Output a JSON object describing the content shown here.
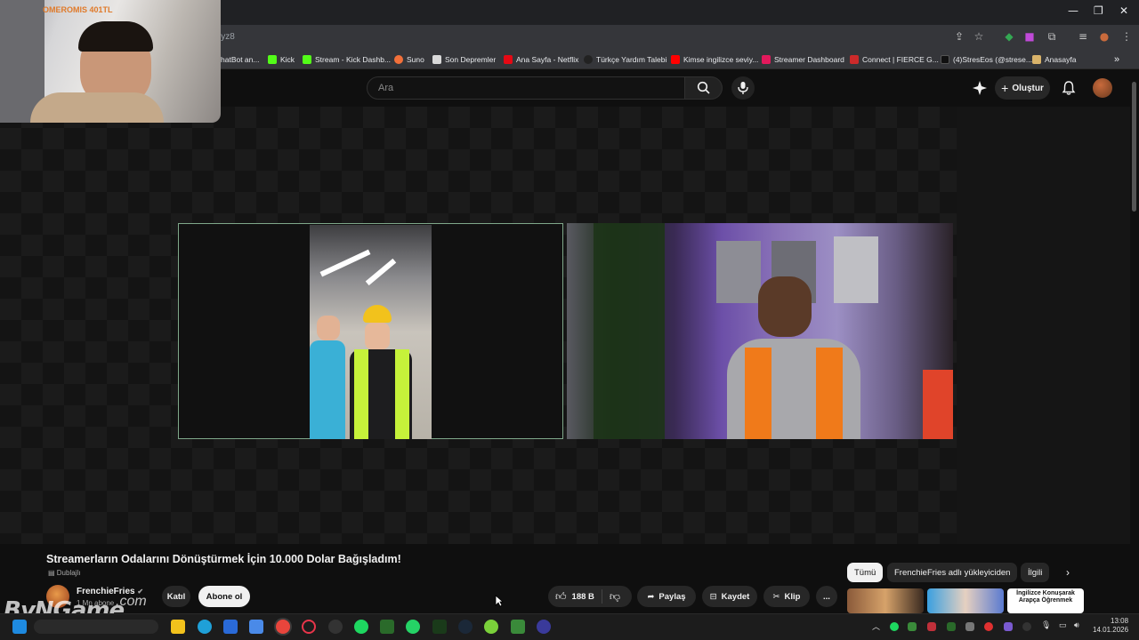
{
  "browser": {
    "url": "iyz8",
    "bookmarks": [
      {
        "label": "hatBot an...",
        "color": "#3a7bd5"
      },
      {
        "label": "Kick",
        "color": "#53fc18"
      },
      {
        "label": "Stream - Kick Dashb...",
        "color": "#53fc18"
      },
      {
        "label": "Suno",
        "color": "#f2703a"
      },
      {
        "label": "Son Depremler",
        "color": "#d9d9d9"
      },
      {
        "label": "Ana Sayfa - Netflix",
        "color": "#e50914"
      },
      {
        "label": "Türkçe Yardım Talebi",
        "color": "#222222"
      },
      {
        "label": "Kimse ingilizce seviy...",
        "color": "#ff0000"
      },
      {
        "label": "Streamer Dashboard",
        "color": "#e2195c"
      },
      {
        "label": "Connect | FIERCE G...",
        "color": "#cc2a2a"
      },
      {
        "label": "(4)StresEos (@strese...",
        "color": "#111111"
      },
      {
        "label": "Anasayfa",
        "color": "#d9b36a"
      }
    ],
    "more": "»"
  },
  "youtube": {
    "search_placeholder": "Ara",
    "create_label": "Oluştur",
    "video_title": "Streamerların Odalarını Dönüştürmek İçin 10.000 Dolar Bağışladım!",
    "dubbed": "Dublajlı",
    "channel_name": "FrenchieFries",
    "channel_subs": "1 Mn abone",
    "join_label": "Katıl",
    "subscribe_label": "Abone ol",
    "likes": "188 B",
    "share_label": "Paylaş",
    "save_label": "Kaydet",
    "clip_label": "Klip",
    "more": "...",
    "chips": [
      "Tümü",
      "FrenchieFries adlı yükleyiciden",
      "İlgili"
    ],
    "thumb3_text": "İngilizce Konuşarak Arapça Öğrenmek"
  },
  "overlay": {
    "webcam_label": "OMEROMIS 401TL",
    "watermark": "ByNGame",
    "watermark_com": ".com"
  },
  "taskbar": {
    "time": "13:08",
    "date": "14.01.2026"
  }
}
